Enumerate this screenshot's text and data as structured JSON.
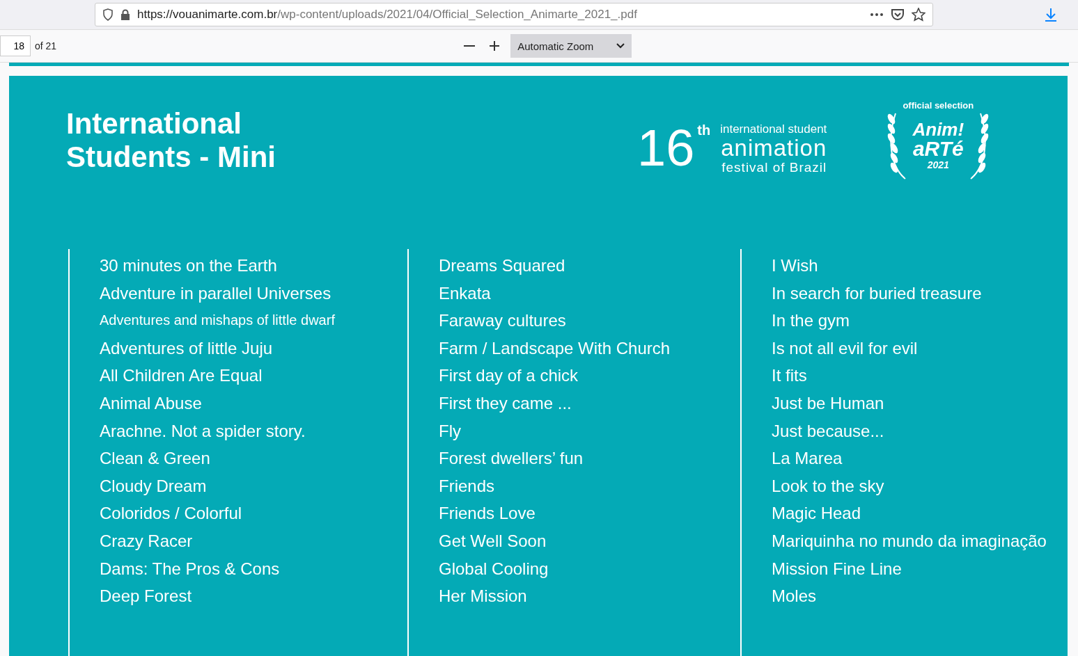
{
  "browser": {
    "url_host": "https://vouanimarte.com.br",
    "url_path": "/wp-content/uploads/2021/04/Official_Selection_Animarte_2021_.pdf"
  },
  "pdf_toolbar": {
    "page_number": "18",
    "page_count": "of 21",
    "zoom": "Automatic Zoom"
  },
  "page": {
    "title_lines": [
      "International",
      "Students - Mini"
    ],
    "festival": {
      "edition": "16",
      "suffix": "th",
      "line_1": "international student",
      "line_2": "animation",
      "line_3": "festival of Brazil"
    },
    "laurel": {
      "caption": "official selection",
      "logo_top": "Anim!",
      "logo_bottom": "aRTé",
      "year": "2021"
    },
    "columns": [
      {
        "films": [
          {
            "title": "30 minutes on the Earth",
            "small": false
          },
          {
            "title": "Adventure in parallel Universes",
            "small": false
          },
          {
            "title": "Adventures and mishaps of little dwarf",
            "small": true
          },
          {
            "title": "Adventures of little Juju",
            "small": false
          },
          {
            "title": "All Children Are Equal",
            "small": false
          },
          {
            "title": "Animal Abuse",
            "small": false
          },
          {
            "title": "Arachne. Not a spider story.",
            "small": false
          },
          {
            "title": "Clean & Green",
            "small": false
          },
          {
            "title": "Cloudy Dream",
            "small": false
          },
          {
            "title": "Coloridos / Colorful",
            "small": false
          },
          {
            "title": "Crazy Racer",
            "small": false
          },
          {
            "title": "Dams: The Pros & Cons",
            "small": false
          },
          {
            "title": "Deep Forest",
            "small": false
          }
        ]
      },
      {
        "films": [
          {
            "title": "Dreams Squared",
            "small": false
          },
          {
            "title": "Enkata",
            "small": false
          },
          {
            "title": "Faraway cultures",
            "small": false
          },
          {
            "title": "Farm / Landscape With Church",
            "small": false
          },
          {
            "title": "First day of a chick",
            "small": false
          },
          {
            "title": "First they came ...",
            "small": false
          },
          {
            "title": "Fly",
            "small": false
          },
          {
            "title": "Forest dwellers’ fun",
            "small": false
          },
          {
            "title": "Friends",
            "small": false
          },
          {
            "title": "Friends Love",
            "small": false
          },
          {
            "title": "Get Well Soon",
            "small": false
          },
          {
            "title": "Global Cooling",
            "small": false
          },
          {
            "title": "Her Mission",
            "small": false
          }
        ]
      },
      {
        "films": [
          {
            "title": "I Wish",
            "small": false
          },
          {
            "title": "In search for buried treasure",
            "small": false
          },
          {
            "title": "In the gym",
            "small": false
          },
          {
            "title": "Is not all evil for evil",
            "small": false
          },
          {
            "title": "It fits",
            "small": false
          },
          {
            "title": "Just be Human",
            "small": false
          },
          {
            "title": "Just because...",
            "small": false
          },
          {
            "title": "La Marea",
            "small": false
          },
          {
            "title": "Look to the sky",
            "small": false
          },
          {
            "title": "Magic Head",
            "small": false
          },
          {
            "title": "Mariquinha no mundo da imaginação",
            "small": false
          },
          {
            "title": "Mission Fine Line",
            "small": false
          },
          {
            "title": "Moles",
            "small": false
          }
        ]
      }
    ]
  }
}
